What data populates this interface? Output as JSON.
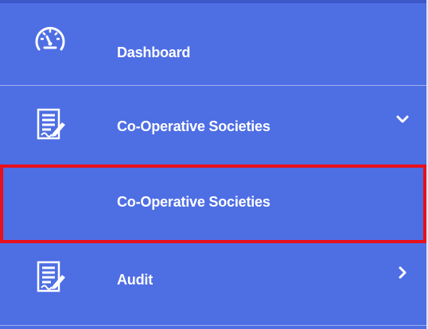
{
  "sidebar": {
    "items": [
      {
        "label": "Dashboard",
        "icon": "speedometer-icon"
      },
      {
        "label": "Co-Operative Societies",
        "icon": "document-signature-icon",
        "expanded": true
      },
      {
        "label": "Co-Operative Societies",
        "selected": true
      },
      {
        "label": "Audit",
        "icon": "document-signature-icon",
        "expanded": false
      }
    ]
  },
  "colors": {
    "sidebar_background": "#4e6ee4",
    "highlight_border": "#e8101a",
    "text": "#ffffff"
  }
}
